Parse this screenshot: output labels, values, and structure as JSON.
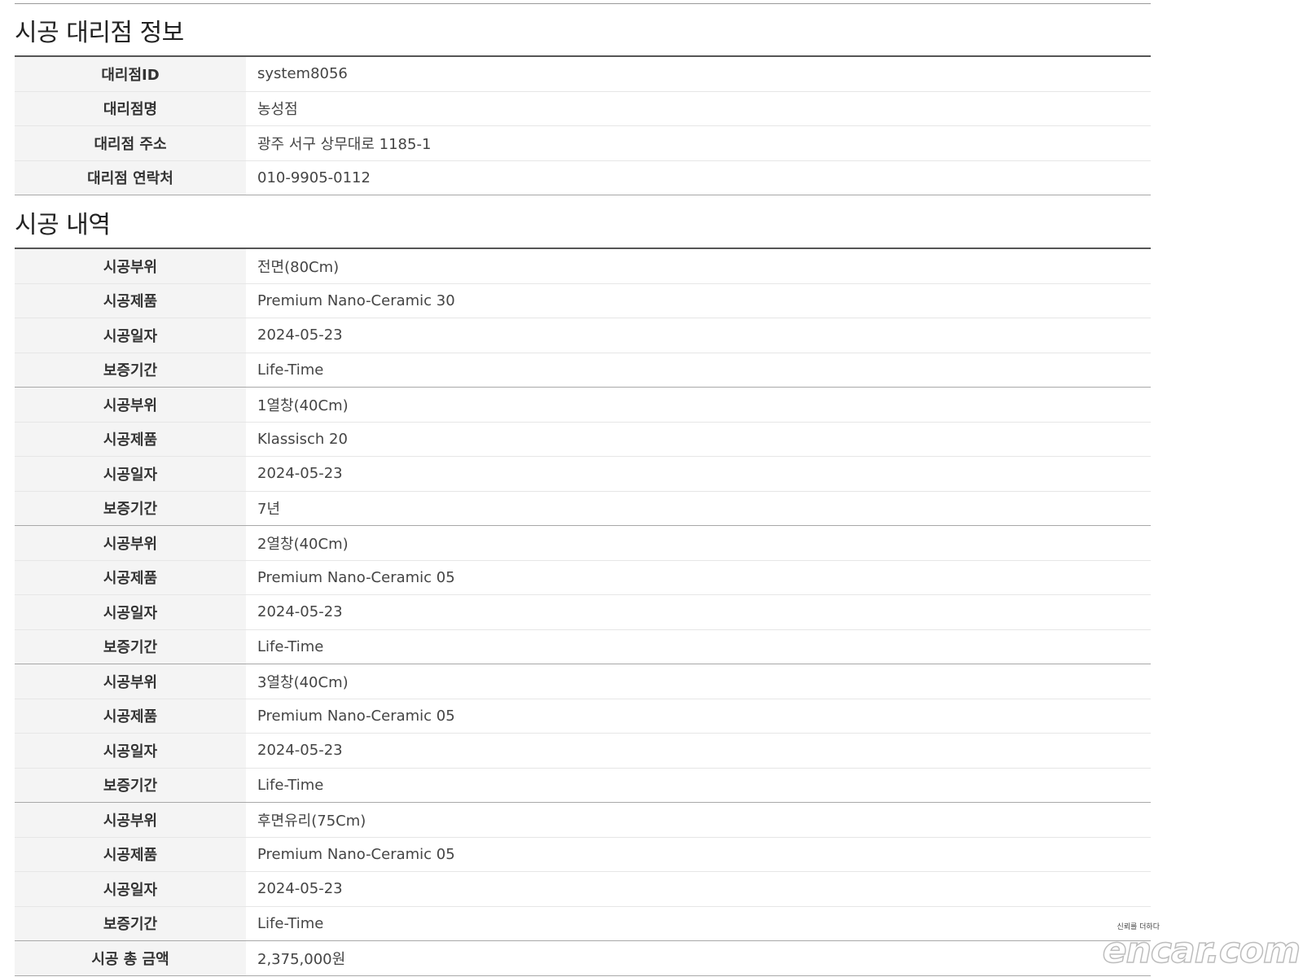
{
  "agency_section": {
    "title": "시공 대리점 정보",
    "rows": [
      {
        "label": "대리점ID",
        "value": "system8056"
      },
      {
        "label": "대리점명",
        "value": "농성점"
      },
      {
        "label": "대리점 주소",
        "value": "광주 서구 상무대로 1185-1"
      },
      {
        "label": "대리점 연락처",
        "value": "010-9905-0112"
      }
    ]
  },
  "history_section": {
    "title": "시공 내역",
    "groups": [
      {
        "part_label": "시공부위",
        "part": "전면(80Cm)",
        "product_label": "시공제품",
        "product": "Premium Nano-Ceramic 30",
        "date_label": "시공일자",
        "date": "2024-05-23",
        "warranty_label": "보증기간",
        "warranty": "Life-Time"
      },
      {
        "part_label": "시공부위",
        "part": "1열창(40Cm)",
        "product_label": "시공제품",
        "product": "Klassisch 20",
        "date_label": "시공일자",
        "date": "2024-05-23",
        "warranty_label": "보증기간",
        "warranty": "7년"
      },
      {
        "part_label": "시공부위",
        "part": "2열창(40Cm)",
        "product_label": "시공제품",
        "product": "Premium Nano-Ceramic 05",
        "date_label": "시공일자",
        "date": "2024-05-23",
        "warranty_label": "보증기간",
        "warranty": "Life-Time"
      },
      {
        "part_label": "시공부위",
        "part": "3열창(40Cm)",
        "product_label": "시공제품",
        "product": "Premium Nano-Ceramic 05",
        "date_label": "시공일자",
        "date": "2024-05-23",
        "warranty_label": "보증기간",
        "warranty": "Life-Time"
      },
      {
        "part_label": "시공부위",
        "part": "후면유리(75Cm)",
        "product_label": "시공제품",
        "product": "Premium Nano-Ceramic 05",
        "date_label": "시공일자",
        "date": "2024-05-23",
        "warranty_label": "보증기간",
        "warranty": "Life-Time"
      }
    ],
    "total_label": "시공 총 금액",
    "total_value": "2,375,000원"
  },
  "watermark": {
    "tagline": "신뢰를 더하다",
    "logo": "encar.com"
  }
}
